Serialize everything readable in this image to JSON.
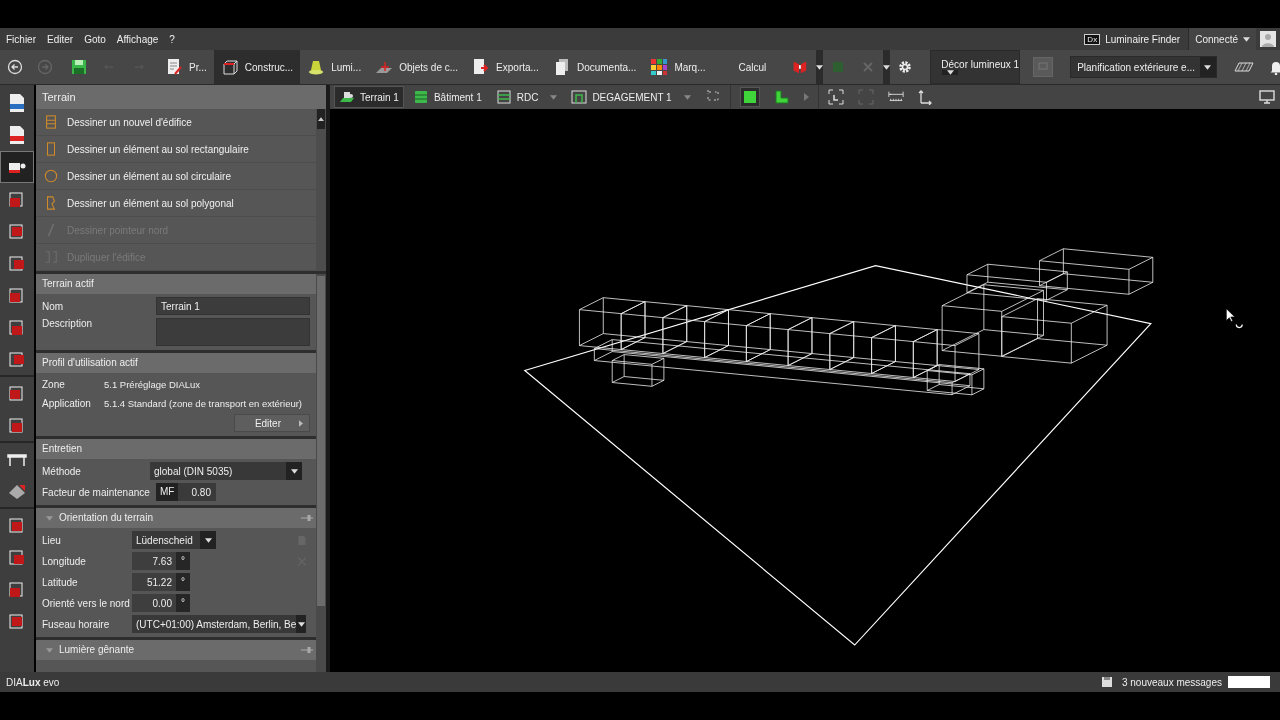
{
  "menu": [
    "Fichier",
    "Editer",
    "Goto",
    "Affichage",
    "?"
  ],
  "header_right": {
    "finder_logo": "Dx",
    "finder": "Luminaire Finder",
    "account": "Connecté"
  },
  "mode_tabs": [
    {
      "label": "Pr...",
      "selected": false
    },
    {
      "label": "Construc...",
      "selected": true
    },
    {
      "label": "Lumi...",
      "selected": false
    },
    {
      "label": "Objets de c...",
      "selected": false
    },
    {
      "label": "Exporta...",
      "selected": false
    },
    {
      "label": "Documenta...",
      "selected": false
    },
    {
      "label": "Marq...",
      "selected": false
    }
  ],
  "calc_label": "Calcul",
  "scene_dropdown": "Décor lumineux 1",
  "planning_dropdown": "Planification extérieure e...",
  "breadcrumbs": [
    {
      "label": "Terrain 1",
      "selected": true,
      "dropdown": false
    },
    {
      "label": "Bâtiment 1",
      "selected": false,
      "dropdown": false
    },
    {
      "label": "RDC",
      "selected": false,
      "dropdown": true
    },
    {
      "label": "DEGAGEMENT 1",
      "selected": false,
      "dropdown": true
    }
  ],
  "panel_title": "Terrain",
  "tools": [
    {
      "label": "Dessiner un nouvel d'édifice",
      "disabled": false
    },
    {
      "label": "Dessiner un élément au sol rectangulaire",
      "disabled": false
    },
    {
      "label": "Dessiner un élément au sol circulaire",
      "disabled": false
    },
    {
      "label": "Dessiner un élément au sol polygonal",
      "disabled": false
    },
    {
      "label": "Dessiner pointeur nord",
      "disabled": true
    },
    {
      "label": "Dupliquer l'édifice",
      "disabled": true
    }
  ],
  "active_site": {
    "title": "Terrain actif",
    "name_label": "Nom",
    "name_value": "Terrain 1",
    "description_label": "Description"
  },
  "usage_profile": {
    "title": "Profil d'utilisation actif",
    "rows": [
      {
        "label": "Zone",
        "value": "5.1 Préréglage DIALux"
      },
      {
        "label": "Application",
        "value": "5.1.4 Standard (zone de transport en extérieur)"
      }
    ],
    "button": "Editer"
  },
  "maintenance": {
    "title": "Entretien",
    "method_label": "Méthode",
    "method_value": "global (DIN 5035)",
    "factor_label": "Facteur de maintenance",
    "factor_prefix": "MF",
    "factor_value": "0.80"
  },
  "orientation": {
    "title": "Orientation du terrain",
    "expanded": true,
    "place_label": "Lieu",
    "place_value": "Lüdenscheid",
    "coords": [
      {
        "label": "Longitude",
        "value": "7.63",
        "unit": "°"
      },
      {
        "label": "Latitude",
        "value": "51.22",
        "unit": "°"
      },
      {
        "label": "Orienté vers le nord",
        "value": "0.00",
        "unit": "°"
      }
    ],
    "timezone_label": "Fuseau horaire",
    "timezone_value": "(UTC+01:00) Amsterdam, Berlin, Be"
  },
  "glare": {
    "title": "Lumière gênante",
    "expanded": true
  },
  "status_bar": {
    "app": "DIA**Lux** evo",
    "messages": "3 nouveaux messages"
  }
}
